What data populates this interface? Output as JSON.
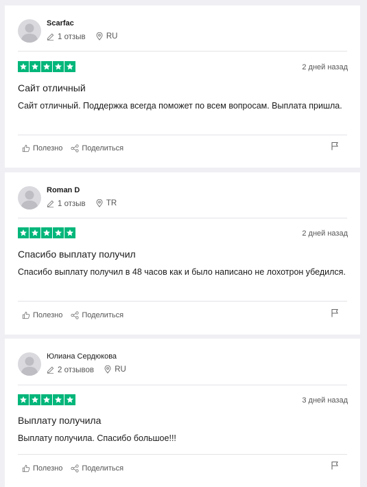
{
  "colors": {
    "star_bg": "#00b67a",
    "page_bg": "#f0f0f4",
    "card_bg": "#ffffff"
  },
  "icons": [
    "avatar-placeholder",
    "pencil-icon",
    "location-pin-icon",
    "star-icon",
    "thumbs-up-icon",
    "share-icon",
    "flag-icon"
  ],
  "reviews": [
    {
      "author": "Scarfac",
      "review_count": "1 отзыв",
      "country": "RU",
      "rating": 5,
      "date": "2 дней назад",
      "title": "Сайт отличный",
      "body": "Сайт отличный. Поддержка всегда поможет по всем вопросам. Выплата пришла.",
      "useful_label": "Полезно",
      "share_label": "Поделиться"
    },
    {
      "author": "Roman D",
      "review_count": "1 отзыв",
      "country": "TR",
      "rating": 5,
      "date": "2 дней назад",
      "title": "Спасибо выплату получил",
      "body": "Спасибо выплату получил в 48 часов как и было написано не лохотрон убедился.",
      "useful_label": "Полезно",
      "share_label": "Поделиться"
    },
    {
      "author": "Юлиана Сердюкова",
      "review_count": "2 отзывов",
      "country": "RU",
      "rating": 5,
      "date": "3 дней назад",
      "title": "Выплату получила",
      "body": "Выплату получила. Спасибо большое!!!",
      "useful_label": "Полезно",
      "share_label": "Поделиться"
    }
  ]
}
